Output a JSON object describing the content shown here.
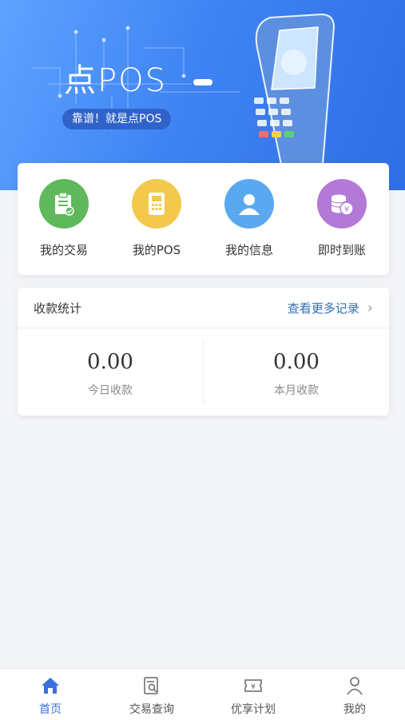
{
  "banner": {
    "title": "点POS",
    "slogan": "靠谱！就是点POS"
  },
  "quick_actions": [
    {
      "label": "我的交易",
      "icon": "clipboard-check-icon",
      "color": "#5fb85c"
    },
    {
      "label": "我的POS",
      "icon": "pos-terminal-icon",
      "color": "#f2c94c"
    },
    {
      "label": "我的信息",
      "icon": "user-icon",
      "color": "#5aa9f0"
    },
    {
      "label": "即时到账",
      "icon": "coins-yen-icon",
      "color": "#b27ad6"
    }
  ],
  "stats": {
    "title": "收款统计",
    "more": "查看更多记录",
    "today": {
      "value": "0.00",
      "label": "今日收款"
    },
    "month": {
      "value": "0.00",
      "label": "本月收款"
    }
  },
  "tabs": [
    {
      "label": "首页",
      "icon": "home-icon",
      "active": true
    },
    {
      "label": "交易查询",
      "icon": "search-document-icon",
      "active": false
    },
    {
      "label": "优享计划",
      "icon": "ticket-icon",
      "active": false
    },
    {
      "label": "我的",
      "icon": "person-icon",
      "active": false
    }
  ],
  "colors": {
    "accent": "#3a6fe0",
    "banner": "#3f84f3",
    "link": "#2f6fb2"
  }
}
